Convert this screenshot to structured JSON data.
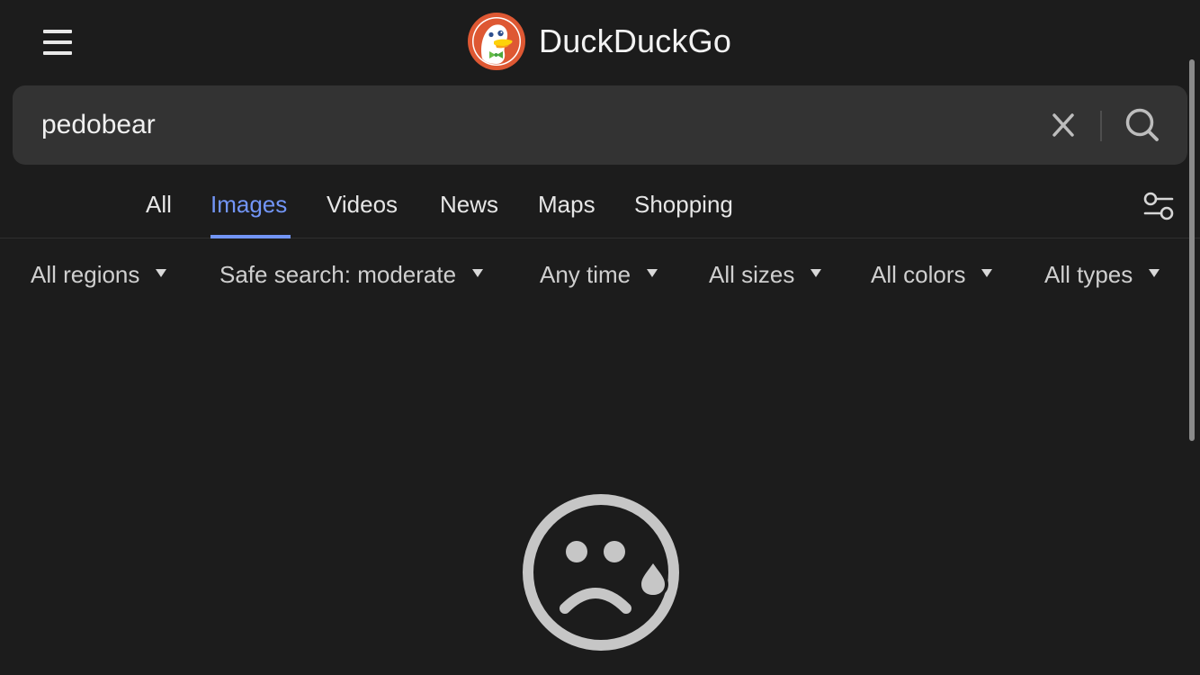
{
  "header": {
    "brand_name": "DuckDuckGo",
    "menu_icon": "hamburger-icon",
    "logo_icon": "duckduckgo-logo"
  },
  "search": {
    "query": "pedobear",
    "placeholder": "",
    "clear_icon": "close-icon",
    "submit_icon": "search-icon"
  },
  "tabs": [
    {
      "label": "All",
      "active": false
    },
    {
      "label": "Images",
      "active": true
    },
    {
      "label": "Videos",
      "active": false
    },
    {
      "label": "News",
      "active": false
    },
    {
      "label": "Maps",
      "active": false
    },
    {
      "label": "Shopping",
      "active": false
    }
  ],
  "settings_icon": "settings-sliders-icon",
  "filters": [
    {
      "label": "All regions"
    },
    {
      "label": "Safe search: moderate"
    },
    {
      "label": "Any time"
    },
    {
      "label": "All sizes"
    },
    {
      "label": "All colors"
    },
    {
      "label": "All types"
    }
  ],
  "empty_state": {
    "icon": "sad-face-icon"
  },
  "colors": {
    "background": "#1c1c1c",
    "search_bg": "#333333",
    "accent": "#7295f6",
    "logo_orange": "#de5833",
    "text": "#e6e6e6",
    "muted": "#cfcfcf",
    "face_gray": "#c6c6c6"
  }
}
